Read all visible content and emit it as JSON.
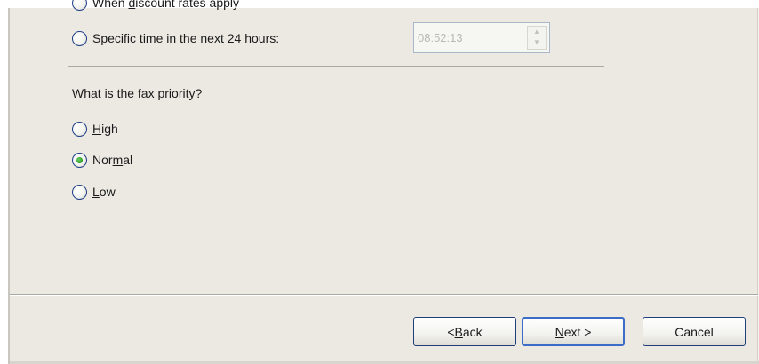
{
  "schedule": {
    "discount_option": {
      "prefix": "When ",
      "mnemonic": "d",
      "rest": "iscount rates apply",
      "selected": false
    },
    "specific_time_option": {
      "prefix": "Specific ",
      "mnemonic": "t",
      "rest": "ime in the next 24 hours:",
      "selected": false
    },
    "time_value": "08:52:13"
  },
  "priority": {
    "question": "What is the fax priority?",
    "options": [
      {
        "prefix": "",
        "mnemonic": "H",
        "rest": "igh",
        "selected": false
      },
      {
        "prefix": "Nor",
        "mnemonic": "m",
        "rest": "al",
        "selected": true
      },
      {
        "prefix": "",
        "mnemonic": "L",
        "rest": "ow",
        "selected": false
      }
    ]
  },
  "buttons": {
    "back": {
      "prefix": "< ",
      "mnemonic": "B",
      "rest": "ack"
    },
    "next": {
      "prefix": "",
      "mnemonic": "N",
      "rest": "ext >"
    },
    "cancel": {
      "label": "Cancel"
    }
  }
}
